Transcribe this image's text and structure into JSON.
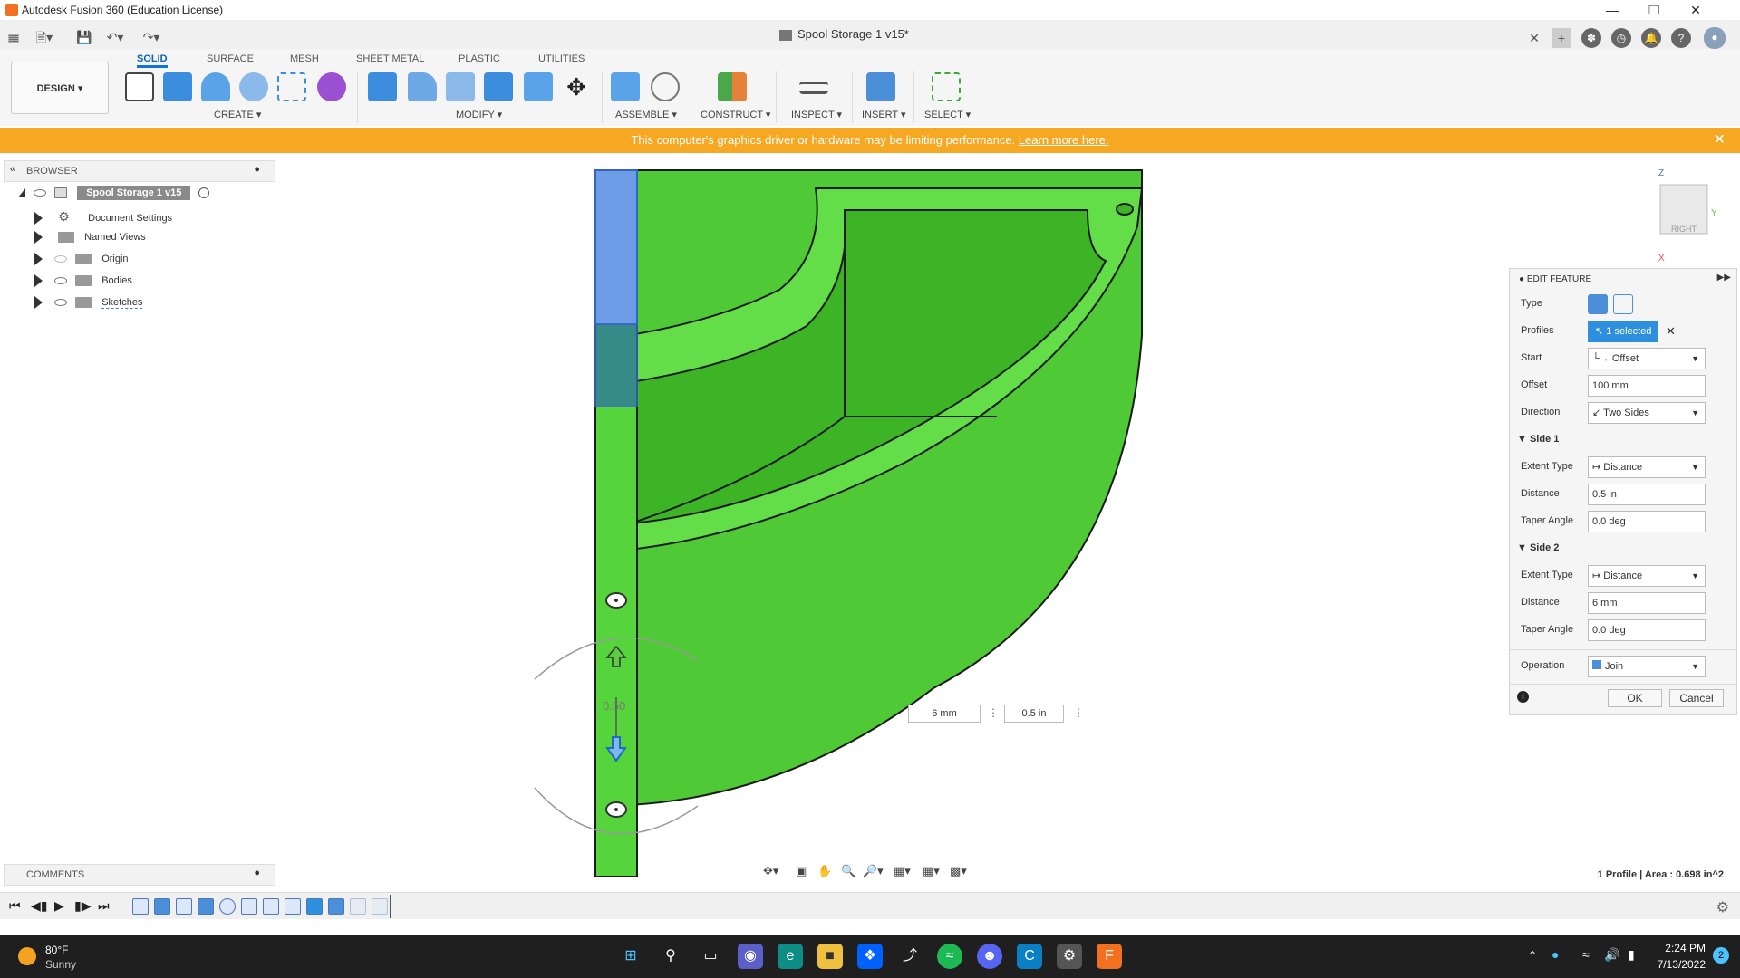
{
  "window": {
    "title": "Autodesk Fusion 360 (Education License)"
  },
  "document": {
    "tab_label": "Spool Storage 1 v15*"
  },
  "ribbon": {
    "tabs": [
      "SOLID",
      "SURFACE",
      "MESH",
      "SHEET METAL",
      "PLASTIC",
      "UTILITIES"
    ],
    "active_tab": "SOLID",
    "workspace_button": "DESIGN ▾",
    "groups": [
      "CREATE ▾",
      "MODIFY ▾",
      "ASSEMBLE ▾",
      "CONSTRUCT ▾",
      "INSPECT ▾",
      "INSERT ▾",
      "SELECT ▾"
    ]
  },
  "warning": {
    "message": "This computer's graphics driver or hardware may be limiting performance.",
    "link": "Learn more here."
  },
  "browser": {
    "title": "BROWSER",
    "root": "Spool Storage 1 v15",
    "items": [
      "Document Settings",
      "Named Views",
      "Origin",
      "Bodies",
      "Sketches"
    ]
  },
  "comments": {
    "title": "COMMENTS"
  },
  "viewcube": {
    "face_label": "RIGHT",
    "axis_z": "Z",
    "axis_y": "Y",
    "axis_x": "X"
  },
  "manipulator": {
    "value_label": "0.50"
  },
  "canvas_inputs": {
    "distance_1": "6 mm",
    "distance_2": "0.5 in"
  },
  "edit_feature": {
    "title": "EDIT FEATURE",
    "type_label": "Type",
    "profiles_label": "Profiles",
    "profiles_value": "1 selected",
    "start_label": "Start",
    "start_value": "Offset",
    "offset_label": "Offset",
    "offset_value": "100 mm",
    "direction_label": "Direction",
    "direction_value": "Two Sides",
    "side1_label": "Side 1",
    "side1_extent_label": "Extent Type",
    "side1_extent_value": "Distance",
    "side1_distance_label": "Distance",
    "side1_distance_value": "0.5 in",
    "side1_taper_label": "Taper Angle",
    "side1_taper_value": "0.0 deg",
    "side2_label": "Side 2",
    "side2_extent_label": "Extent Type",
    "side2_extent_value": "Distance",
    "side2_distance_label": "Distance",
    "side2_distance_value": "6 mm",
    "side2_taper_label": "Taper Angle",
    "side2_taper_value": "0.0 deg",
    "operation_label": "Operation",
    "operation_value": "Join",
    "ok_label": "OK",
    "cancel_label": "Cancel"
  },
  "status": {
    "profile_info": "1 Profile | Area : 0.698 in^2"
  },
  "taskbar": {
    "weather_temp": "80°F",
    "weather_desc": "Sunny",
    "time": "2:24 PM",
    "date": "7/13/2022",
    "notification_count": "2"
  },
  "colors": {
    "model_green": "#55d43c",
    "accent_blue": "#0b73d9",
    "warning_orange": "#f7a823"
  }
}
